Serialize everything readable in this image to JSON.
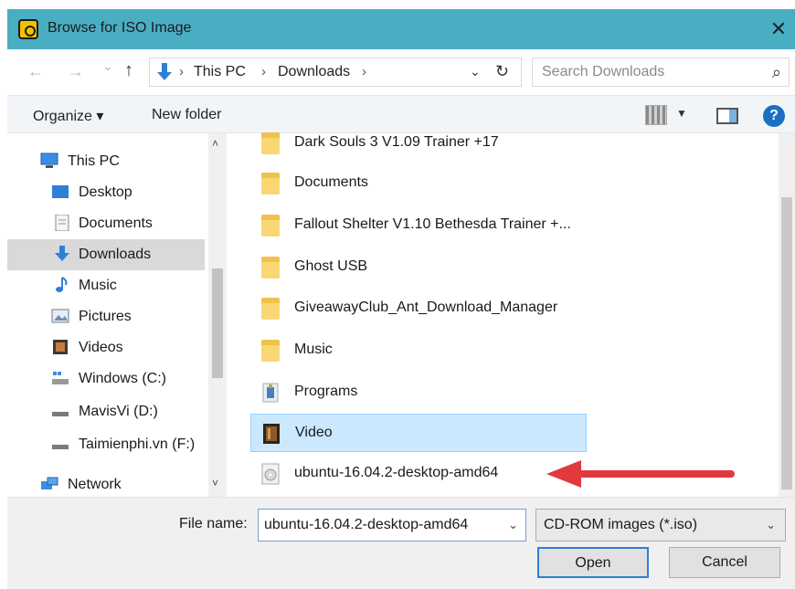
{
  "window": {
    "title": "Browse for ISO Image",
    "close_glyph": "✕"
  },
  "nav": {
    "back_glyph": "←",
    "forward_glyph": "→",
    "recent_glyph": "⌄",
    "up_glyph": "↑"
  },
  "address": {
    "crumbs": [
      "This PC",
      "Downloads"
    ],
    "separator": "›",
    "dropdown_glyph": "⌄",
    "refresh_glyph": "↻"
  },
  "search": {
    "placeholder": "Search Downloads",
    "icon_glyph": "⌕"
  },
  "toolbar": {
    "organize_label": "Organize ▾",
    "new_folder_label": "New folder",
    "view_dd_glyph": "▼",
    "help_glyph": "?"
  },
  "sidebar": {
    "items": [
      {
        "label": "This PC",
        "icon": "computer-icon"
      },
      {
        "label": "Desktop",
        "icon": "desktop-icon"
      },
      {
        "label": "Documents",
        "icon": "documents-icon"
      },
      {
        "label": "Downloads",
        "icon": "downloads-icon",
        "selected": true
      },
      {
        "label": "Music",
        "icon": "music-icon"
      },
      {
        "label": "Pictures",
        "icon": "pictures-icon"
      },
      {
        "label": "Videos",
        "icon": "videos-icon"
      },
      {
        "label": "Windows (C:)",
        "icon": "drive-icon"
      },
      {
        "label": "MavisVi (D:)",
        "icon": "drive-icon"
      },
      {
        "label": "Taimienphi.vn (F:)",
        "icon": "drive-icon"
      },
      {
        "label": "Network",
        "icon": "network-icon"
      }
    ],
    "scroll_up_glyph": "˄",
    "scroll_down_glyph": "˅"
  },
  "files": [
    {
      "name": "Dark Souls 3 V1.09 Trainer +17",
      "icon": "folder-icon"
    },
    {
      "name": "Documents",
      "icon": "folder-icon"
    },
    {
      "name": "Fallout Shelter V1.10 Bethesda Trainer +...",
      "icon": "folder-icon"
    },
    {
      "name": "Ghost USB",
      "icon": "folder-icon"
    },
    {
      "name": "GiveawayClub_Ant_Download_Manager",
      "icon": "folder-icon"
    },
    {
      "name": "Music",
      "icon": "folder-icon"
    },
    {
      "name": "Programs",
      "icon": "programs-folder-icon"
    },
    {
      "name": "Video",
      "icon": "video-folder-icon",
      "selected": true
    },
    {
      "name": "ubuntu-16.04.2-desktop-amd64",
      "icon": "disc-image-icon"
    }
  ],
  "footer": {
    "file_name_label": "File name:",
    "file_name_value": "ubuntu-16.04.2-desktop-amd64",
    "file_type_value": "CD-ROM images (*.iso)",
    "dropdown_glyph": "⌄",
    "open_label": "Open",
    "cancel_label": "Cancel"
  },
  "colors": {
    "titlebar": "#4aaec3",
    "selection": "#cce8ff",
    "annotation_arrow": "#e03a3e"
  }
}
